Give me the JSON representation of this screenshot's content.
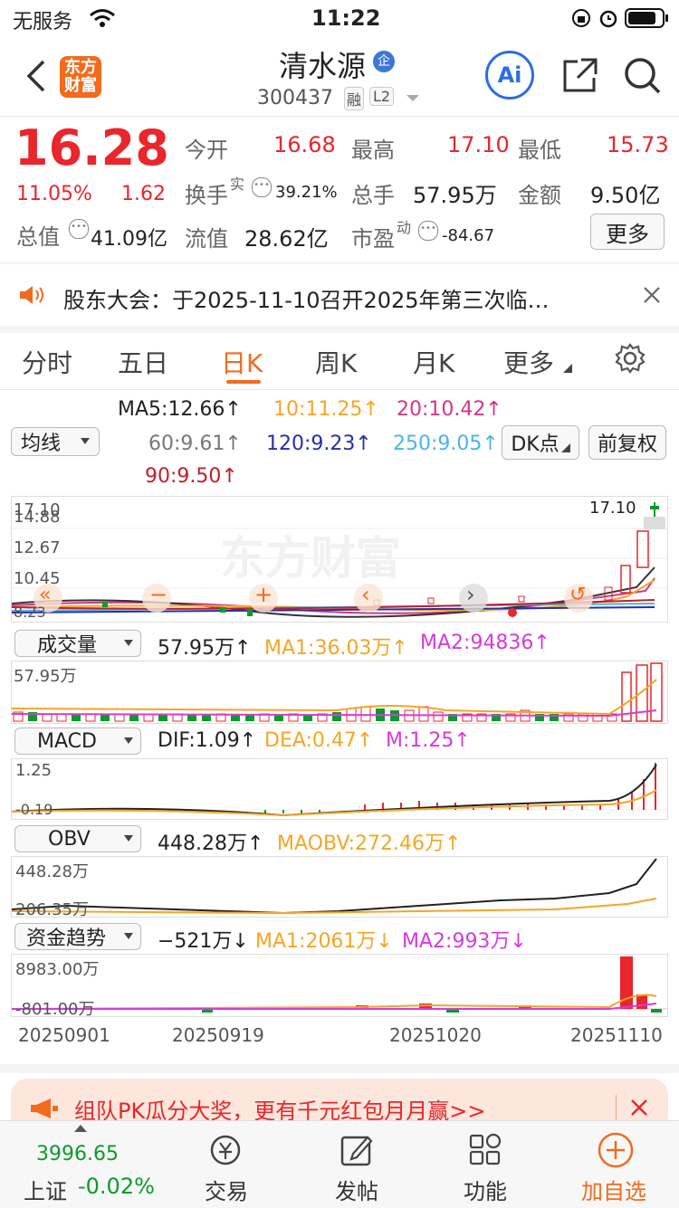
{
  "status_bar": {
    "carrier": "无服务",
    "time": "11:22"
  },
  "header": {
    "logo_text": "东方财富",
    "stock_name": "清水源",
    "badge": "企",
    "stock_code": "300437",
    "tag_rong": "融",
    "tag_l2": "L2",
    "ai_label": "Ai"
  },
  "quote": {
    "price": "16.28",
    "pct": "11.05%",
    "change": "1.62",
    "open_label": "今开",
    "open": "16.68",
    "high_label": "最高",
    "high": "17.10",
    "low_label": "最低",
    "low": "15.73",
    "turnover_label": "换手",
    "turnover_sup": "实",
    "turnover": "39.21%",
    "volume_label": "总手",
    "volume": "57.95万",
    "amount_label": "金额",
    "amount": "9.50亿",
    "mktcap_label": "总值",
    "mktcap": "41.09亿",
    "float_label": "流值",
    "float": "28.62亿",
    "pe_label": "市盈",
    "pe_sup": "动",
    "pe": "-84.67",
    "more_label": "更多"
  },
  "notice": {
    "text": "股东大会：于2025-11-10召开2025年第三次临…"
  },
  "tabs": [
    {
      "label": "分时"
    },
    {
      "label": "五日"
    },
    {
      "label": "日K"
    },
    {
      "label": "周K"
    },
    {
      "label": "月K"
    },
    {
      "label": "更多"
    }
  ],
  "ma_panel": {
    "selector": "均线",
    "ma5": "MA5:12.66↑",
    "ma10": "10:11.25↑",
    "ma20": "20:10.42↑",
    "ma60": "60:9.61↑",
    "ma120": "120:9.23↑",
    "ma250": "250:9.05↑",
    "ma90": "90:9.50↑",
    "dk_label": "DK点",
    "fq_label": "前复权"
  },
  "kline": {
    "y_top": "17.10",
    "y2": "14.88",
    "y3": "12.67",
    "y4": "10.45",
    "y_low": "8.23",
    "last_marker": "17.10",
    "watermark": "东方财富"
  },
  "volume": {
    "selector": "成交量",
    "value": "57.95万↑",
    "ma1": "MA1:36.03万↑",
    "ma2": "MA2:94836↑",
    "axis_top": "57.95万"
  },
  "macd": {
    "selector": "MACD",
    "dif": "DIF:1.09↑",
    "dea": "DEA:0.47↑",
    "m": "M:1.25↑",
    "axis_top": "1.25",
    "axis_low": "-0.19"
  },
  "obv": {
    "selector": "OBV",
    "value": "448.28万↑",
    "maobv": "MAOBV:272.46万↑",
    "axis_top": "448.28万",
    "axis_low": "206.35万"
  },
  "fund": {
    "selector": "资金趋势",
    "value": "−521万↓",
    "ma1": "MA1:2061万↓",
    "ma2": "MA2:993万↓",
    "axis_top": "8983.00万",
    "axis_low": "-801.00万"
  },
  "dates": [
    "20250901",
    "20250919",
    "20251020",
    "20251110"
  ],
  "promo": {
    "text": "组队PK瓜分大奖，更有千元红包月月赢>>"
  },
  "bottom": {
    "index_value": "3996.65",
    "index_name": "上证",
    "index_pct": "-0.02%",
    "trade": "交易",
    "post": "发帖",
    "func": "功能",
    "add": "加自选"
  },
  "colors": {
    "up": "#e8262b",
    "down": "#0a9b2a",
    "accent": "#f26b1d",
    "ai_blue": "#2b6de4"
  }
}
